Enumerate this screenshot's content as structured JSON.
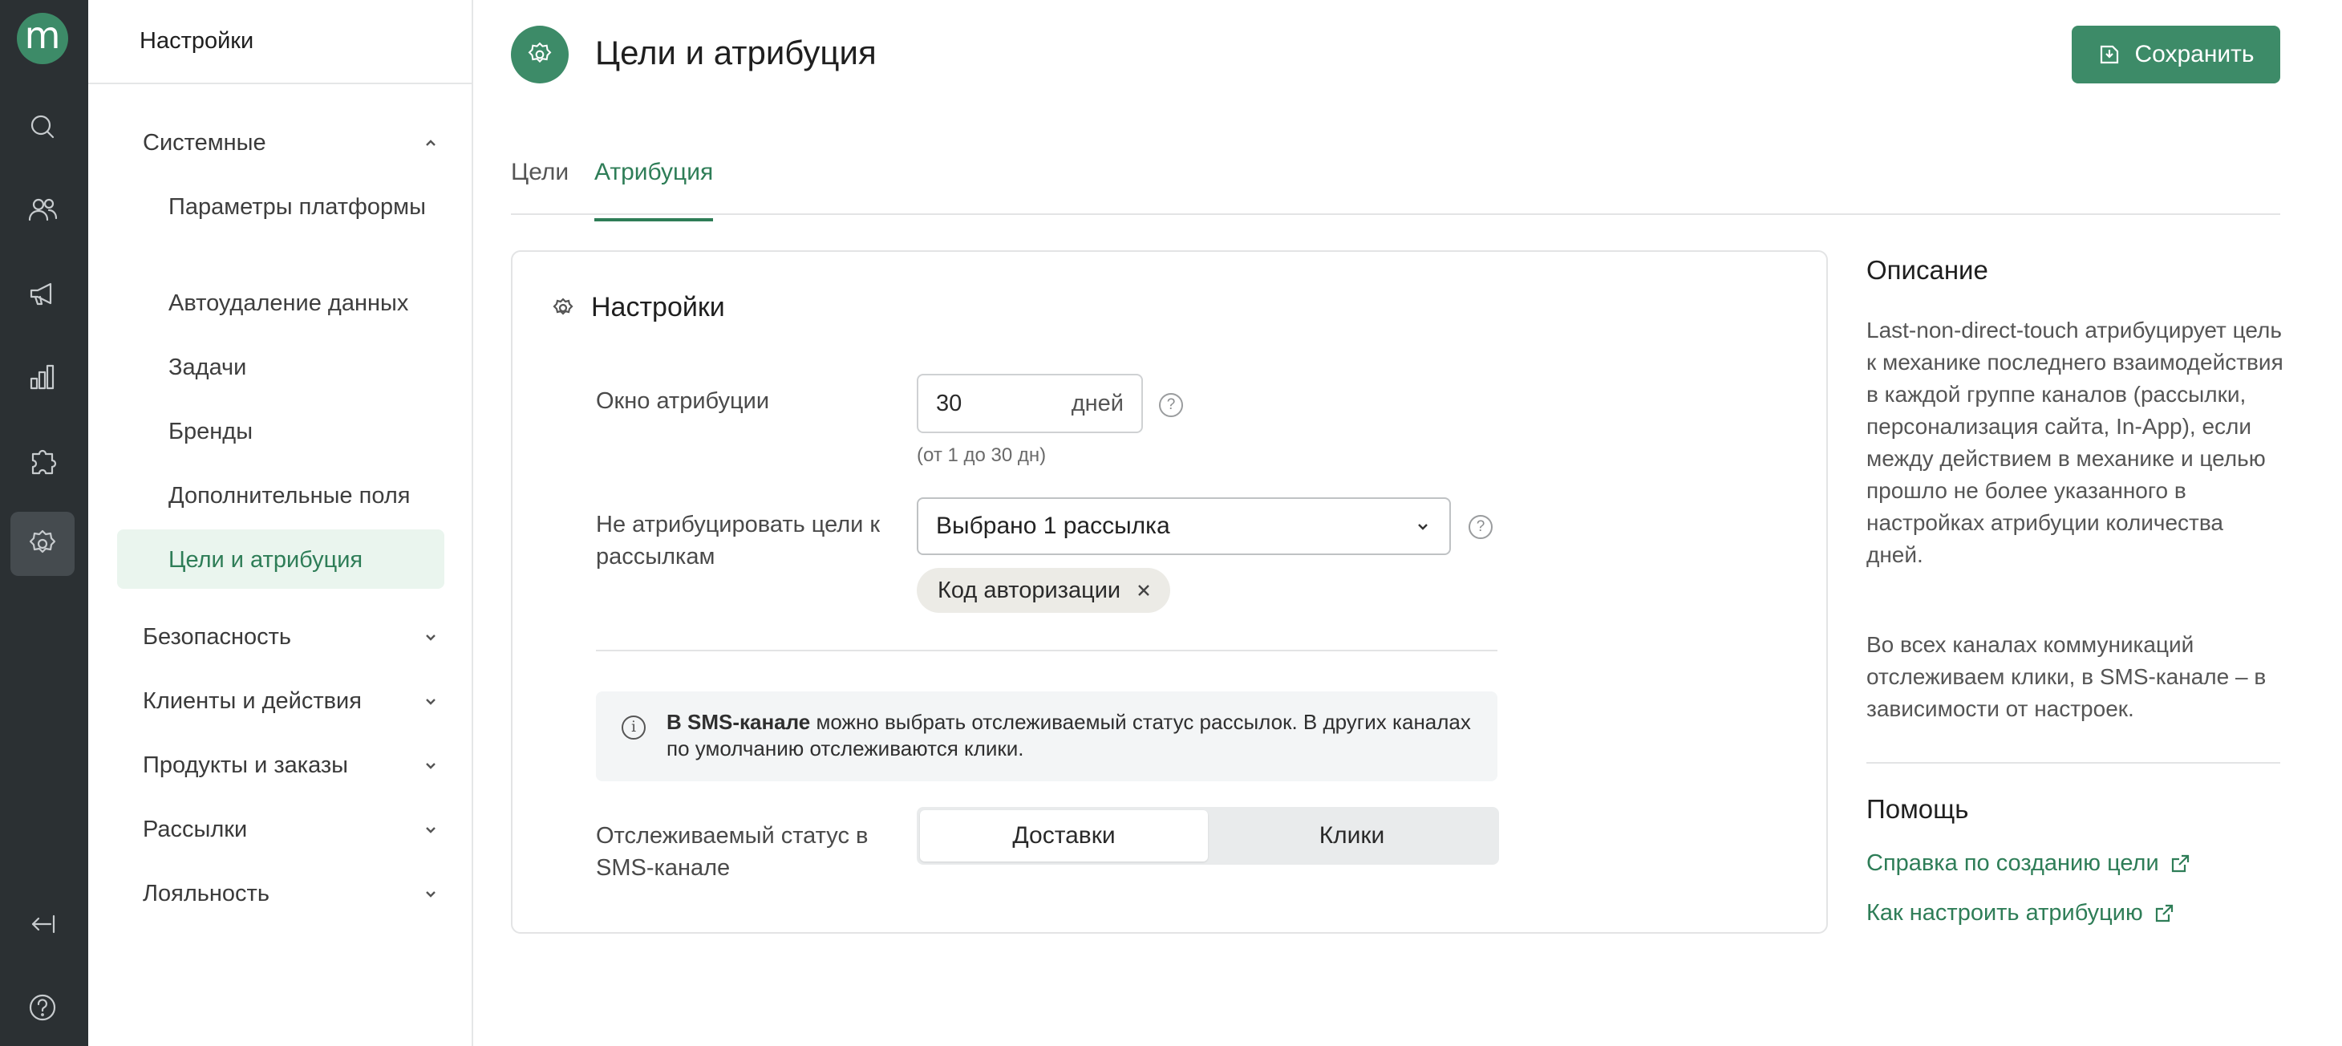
{
  "rail": {
    "logo_letter": "m",
    "items": [
      "search-icon",
      "users-icon",
      "megaphone-icon",
      "chart-icon",
      "puzzle-icon",
      "settings-icon"
    ],
    "bottom": [
      "collapse-icon",
      "help-icon"
    ]
  },
  "sidebar": {
    "header": "Настройки",
    "system_group": "Системные",
    "system_items": [
      "Параметры платформы",
      "Автоудаление данных",
      "Задачи",
      "Бренды",
      "Дополнительные поля",
      "Цели и атрибуция"
    ],
    "groups": [
      "Безопасность",
      "Клиенты и действия",
      "Продукты и заказы",
      "Рассылки",
      "Лояльность"
    ]
  },
  "header": {
    "title": "Цели и атрибуция",
    "save_label": "Сохранить"
  },
  "tabs": [
    "Цели",
    "Атрибуция"
  ],
  "settings": {
    "title": "Настройки",
    "window_label": "Окно атрибуции",
    "window_value": "30",
    "window_unit": "дней",
    "window_hint": "(от 1 до 30 дн)",
    "exclude_label": "Не атрибуцировать цели к рассылкам",
    "exclude_select": "Выбрано 1 рассылка",
    "exclude_chip": "Код авторизации",
    "info_bold": "В SMS-канале",
    "info_text": " можно выбрать отслеживаемый статус рассылок. В других каналах по умолчанию отслеживаются клики.",
    "status_label": "Отслеживаемый статус в SMS-канале",
    "status_options": [
      "Доставки",
      "Клики"
    ],
    "status_selected": "Доставки"
  },
  "description": {
    "title": "Описание",
    "p1": "Last-non-direct-touch атрибуцирует цель к механике последнего взаимодействия в каждой группе каналов (рассылки, персонализация сайта, In-App), если между действием в механике и целью прошло не более указанного в настройках атрибуции количества дней.",
    "p2": "Во всех каналах коммуникаций отслеживаем клики, в SMS-канале – в зависимости от настроек.",
    "help_title": "Помощь",
    "links": [
      "Справка по созданию цели",
      "Как настроить атрибуцию"
    ]
  },
  "colors": {
    "accent": "#3d8b68",
    "rail_bg": "#2b3033",
    "active_bg": "#eaf5ee"
  }
}
